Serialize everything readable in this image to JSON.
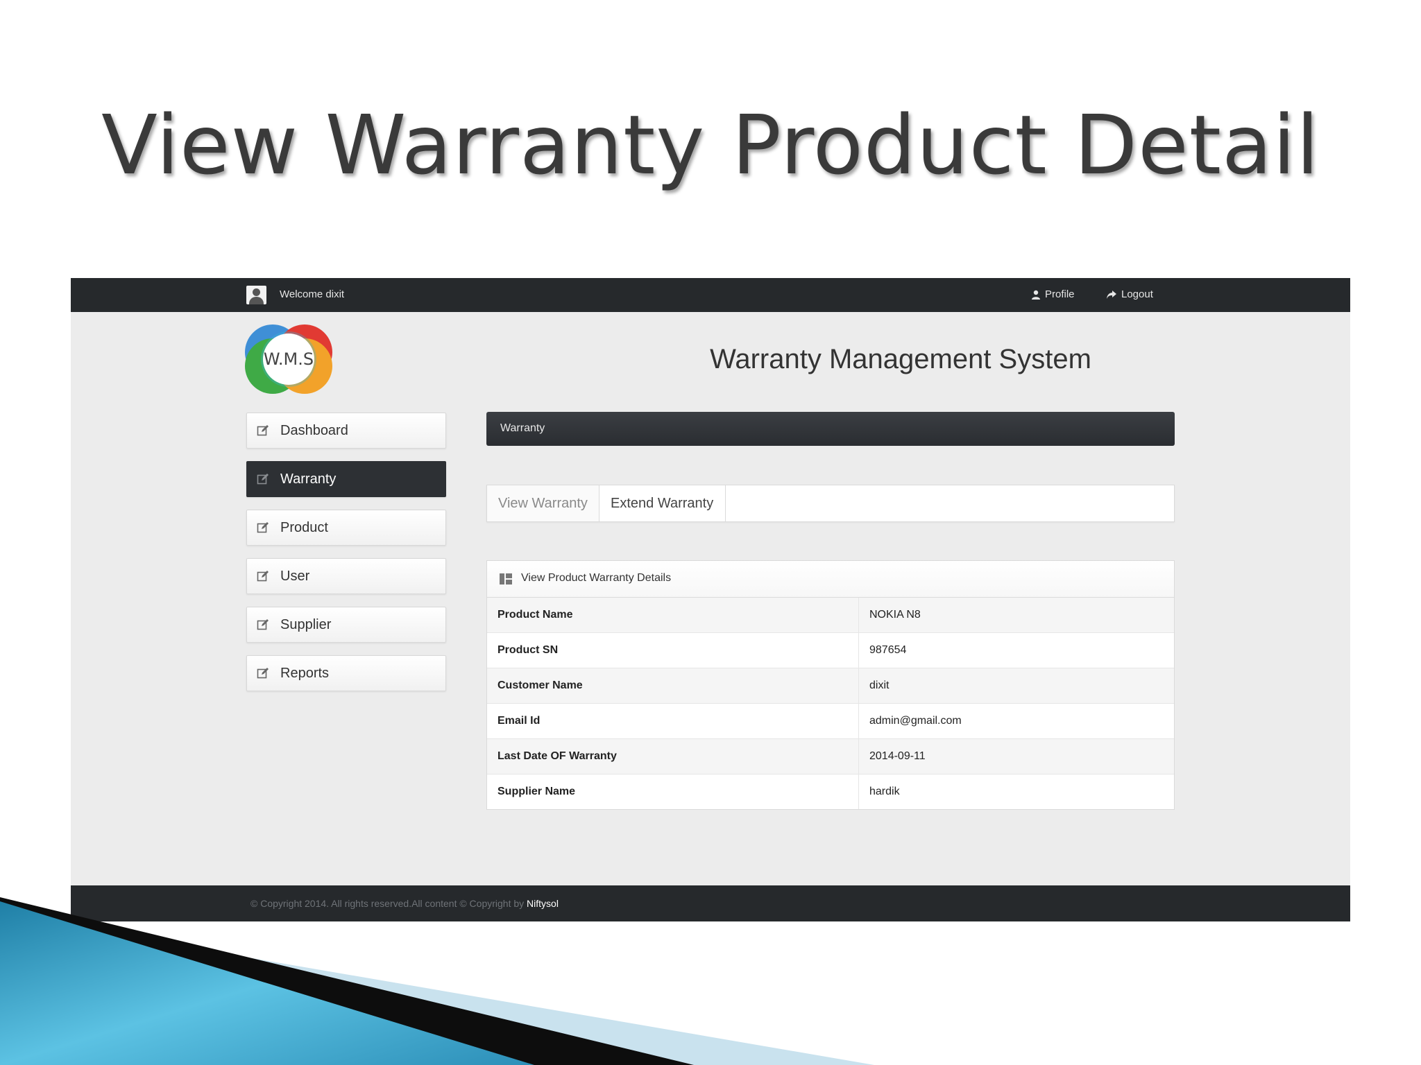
{
  "slide": {
    "title": "View Warranty Product Detail"
  },
  "topbar": {
    "welcome": "Welcome dixit",
    "profile_label": "Profile",
    "logout_label": "Logout"
  },
  "branding": {
    "logo_text": "W.M.S",
    "app_title": "Warranty Management System"
  },
  "sidebar": {
    "items": [
      {
        "label": "Dashboard",
        "active": false
      },
      {
        "label": "Warranty",
        "active": true
      },
      {
        "label": "Product",
        "active": false
      },
      {
        "label": "User",
        "active": false
      },
      {
        "label": "Supplier",
        "active": false
      },
      {
        "label": "Reports",
        "active": false
      }
    ]
  },
  "main": {
    "section_title": "Warranty",
    "tabs": [
      {
        "label": "View Warranty",
        "active": true
      },
      {
        "label": "Extend Warranty",
        "active": false
      }
    ],
    "details": {
      "title": "View Product Warranty Details",
      "rows": [
        {
          "label": "Product Name",
          "value": "NOKIA N8"
        },
        {
          "label": "Product SN",
          "value": "987654"
        },
        {
          "label": "Customer Name",
          "value": "dixit"
        },
        {
          "label": "Email Id",
          "value": "admin@gmail.com"
        },
        {
          "label": "Last Date OF Warranty",
          "value": "2014-09-11"
        },
        {
          "label": "Supplier Name",
          "value": "hardik"
        }
      ]
    }
  },
  "footer": {
    "copyright_text": "© Copyright 2014. All rights reserved.All content © Copyright by ",
    "brand": "Niftysol"
  },
  "icons": {
    "avatar": "user-avatar-icon",
    "profile": "user-icon",
    "logout": "share-arrow-icon",
    "nav": "edit-square-icon",
    "details": "grid-icon"
  },
  "colors": {
    "topbar_bg": "#26292c",
    "content_bg": "#ececec",
    "active_nav_bg": "#2d3034",
    "section_bar_bg": "#2f3236",
    "decor_blue": "#3ea6c9"
  }
}
